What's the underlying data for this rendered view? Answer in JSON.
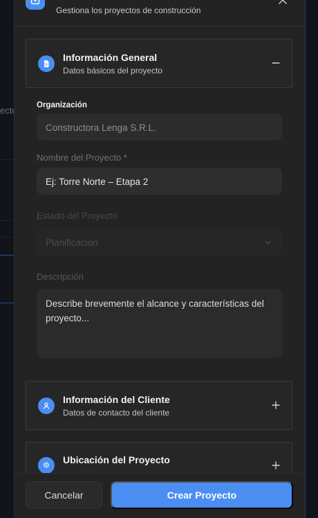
{
  "background": {
    "fragment_text": "ecto"
  },
  "modal": {
    "subtitle": "Gestiona los proyectos de construcción",
    "sections": {
      "general": {
        "title": "Información General",
        "subtitle": "Datos básicos del proyecto",
        "state": "expanded"
      },
      "client": {
        "title": "Información del Cliente",
        "subtitle": "Datos de contacto del cliente",
        "state": "collapsed"
      },
      "location": {
        "title": "Ubicación del Proyecto",
        "state": "collapsed"
      }
    },
    "form": {
      "organization_label": "Organización",
      "organization_value": "Constructora Lenga S.R.L.",
      "project_name_label": "Nombre del Proyecto *",
      "project_name_placeholder": "Ej: Torre Norte – Etapa 2",
      "status_label": "Estado del Proyecto",
      "status_value": "Planificación",
      "description_label": "Descripción",
      "description_placeholder": "Describe brevemente el alcance y características del proyecto..."
    },
    "footer": {
      "cancel_label": "Cancelar",
      "create_label": "Crear Proyecto"
    },
    "colors": {
      "accent": "#4a8ef2",
      "modal_bg": "#232323"
    }
  }
}
